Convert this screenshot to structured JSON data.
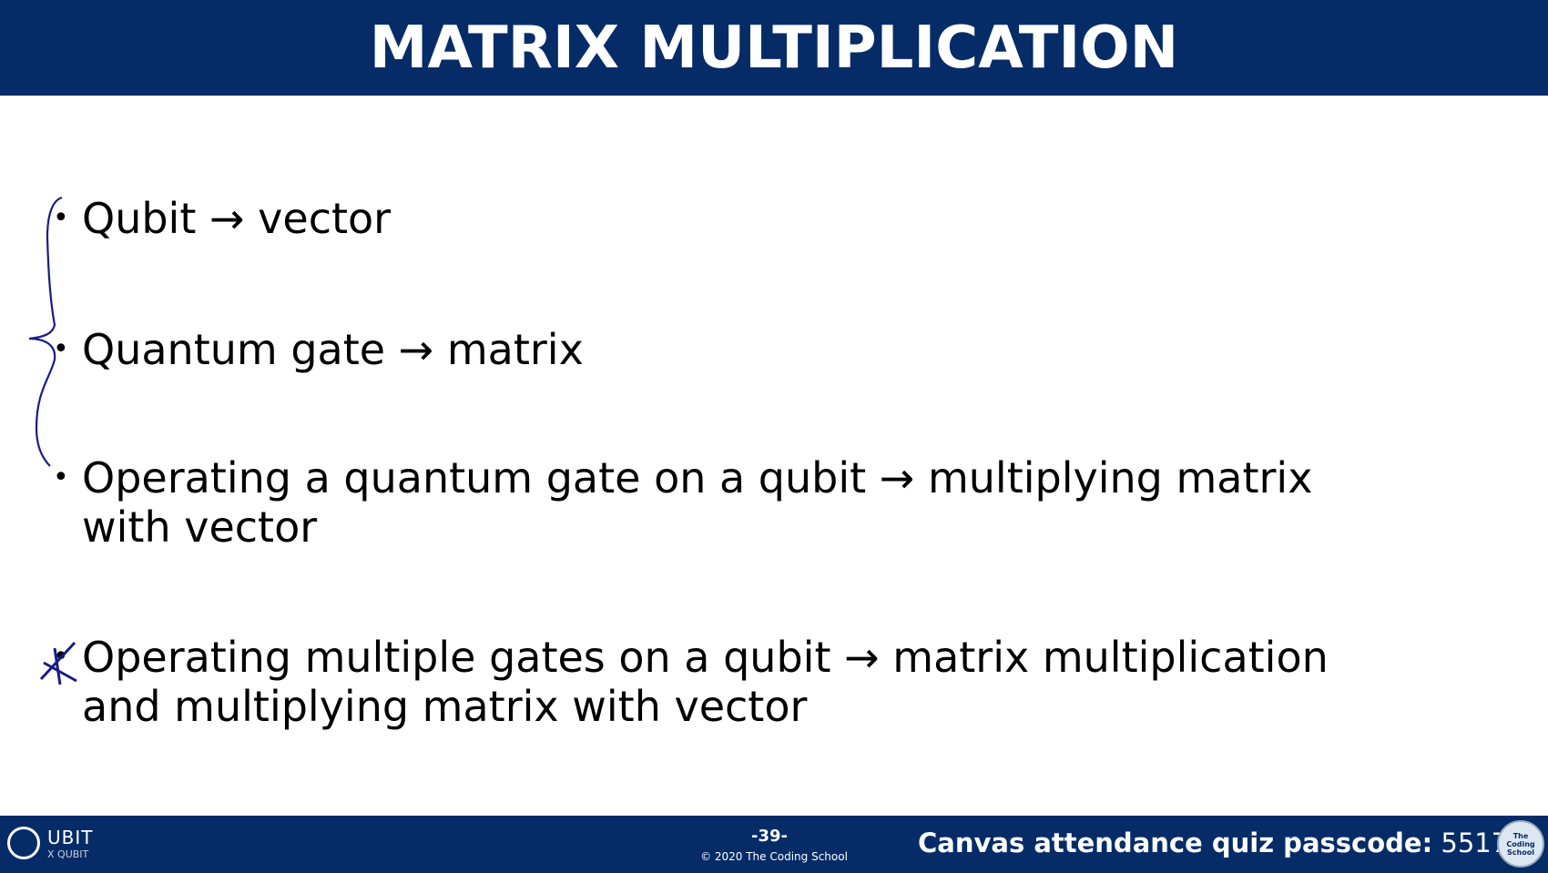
{
  "header": {
    "title": "MATRIX MULTIPLICATION"
  },
  "bullets": [
    {
      "text": "Qubit → vector"
    },
    {
      "text": "Quantum gate → matrix"
    },
    {
      "text": "Operating a quantum gate on a qubit → multiplying matrix with vector"
    },
    {
      "text": "Operating multiple gates on a qubit → matrix multiplication and multiplying matrix with vector"
    }
  ],
  "bullet_symbol": "•",
  "footer": {
    "logo": {
      "main": "UBIT",
      "sub": "X QUBIT"
    },
    "page_number": "-39-",
    "copyright": "© 2020 The Coding School",
    "passcode_label": "Canvas attendance quiz passcode:",
    "passcode_value": "5517",
    "seal_text": "The Coding School"
  },
  "colors": {
    "brand": "#052c67",
    "ink": "#1a1a8a"
  }
}
